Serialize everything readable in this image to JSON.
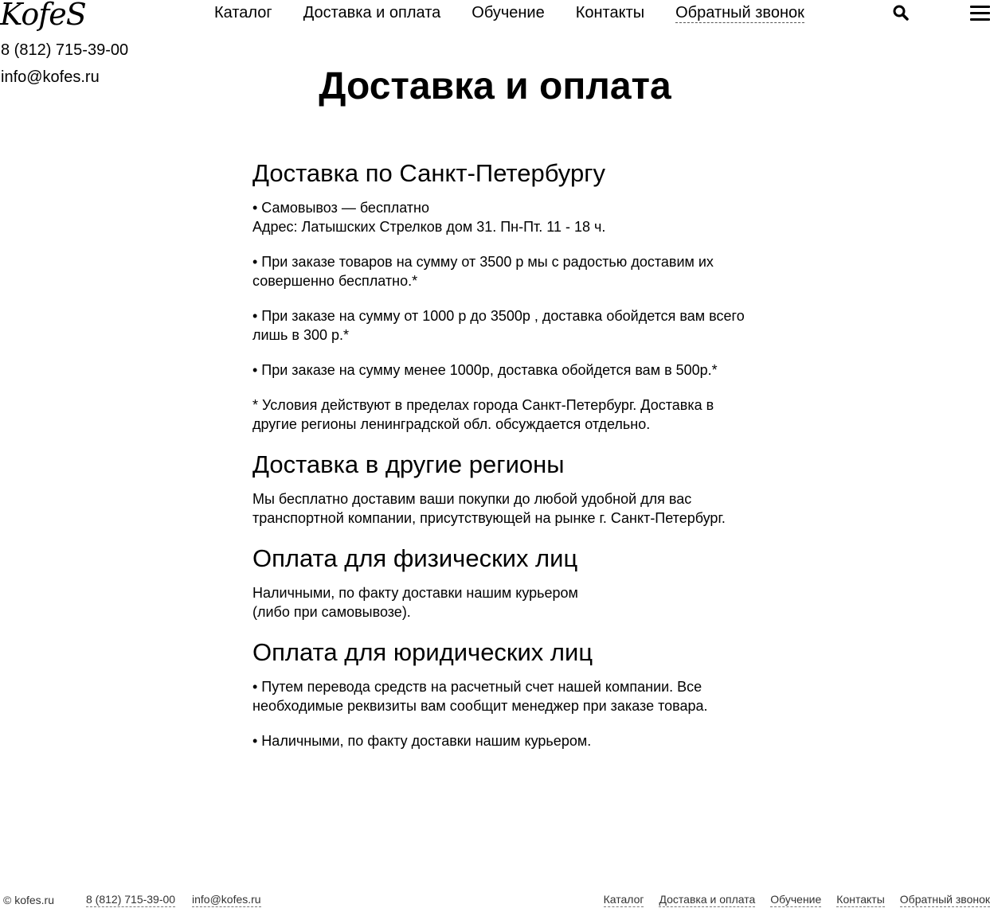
{
  "logo": "KofeS",
  "nav": {
    "items": [
      "Каталог",
      "Доставка и оплата",
      "Обучение",
      "Контакты"
    ],
    "callback": "Обратный звонок"
  },
  "contacts": {
    "phone": "8 (812) 715-39-00",
    "email": "info@kofes.ru"
  },
  "page": {
    "title": "Доставка и оплата"
  },
  "sections": [
    {
      "title": "Доставка по Санкт-Петербургу",
      "paragraphs": [
        "• Самовывоз — бесплатно\nАдрес: Латышских Стрелков дом 31.  Пн-Пт. 11 - 18 ч.",
        "• При заказе товаров на сумму от 3500 р мы с радостью доставим их совершенно бесплатно.*",
        "• При заказе на сумму от 1000 р до 3500р , доставка обойдется вам всего лишь в 300 р.*",
        "• При заказе на сумму менее 1000р, доставка обойдется вам в 500р.*",
        " * Условия действуют в пределах города Санкт-Петербург. Доставка в другие регионы ленинградской обл. обсуждается отдельно."
      ]
    },
    {
      "title": "Доставка в другие регионы",
      "paragraphs": [
        "Мы бесплатно доставим ваши покупки до любой удобной для вас транспортной компании, присутствующей на рынке г. Санкт-Петербург."
      ]
    },
    {
      "title": "Оплата для физических лиц",
      "paragraphs": [
        "Наличными, по факту доставки нашим курьером\n(либо при самовывозе)."
      ]
    },
    {
      "title": "Оплата для юридических лиц",
      "paragraphs": [
        "• Путем перевода средств на расчетный счет нашей компании. Все необходимые реквизиты вам сообщит менеджер при заказе товара.",
        "• Наличными, по факту доставки нашим курьером."
      ]
    }
  ],
  "footer": {
    "copyright": "© kofes.ru",
    "phone": "8 (812) 715-39-00",
    "email": "info@kofes.ru",
    "nav": [
      "Каталог",
      "Доставка и оплата",
      "Обучение",
      "Контакты",
      "Обратный звонок"
    ]
  },
  "icons": {
    "search": "search-icon",
    "menu": "hamburger-menu-icon"
  }
}
